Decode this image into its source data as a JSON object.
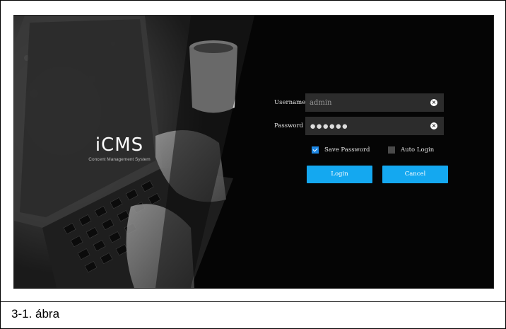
{
  "brand": {
    "title": "iCMS",
    "subtitle": "Concent  Management  System"
  },
  "login": {
    "username_label": "Username",
    "username_value": "admin",
    "password_label": "Password",
    "password_masked": "●●●●●●",
    "save_password_label": "Save Password",
    "save_password_checked": true,
    "auto_login_label": "Auto Login",
    "auto_login_checked": false,
    "login_button": "Login",
    "cancel_button": "Cancel",
    "clear_icon": "clear-icon"
  },
  "caption": "3-1. ábra",
  "colors": {
    "accent": "#14a8f0",
    "field_bg": "#2c2c2c",
    "panel_bg": "#050505"
  }
}
